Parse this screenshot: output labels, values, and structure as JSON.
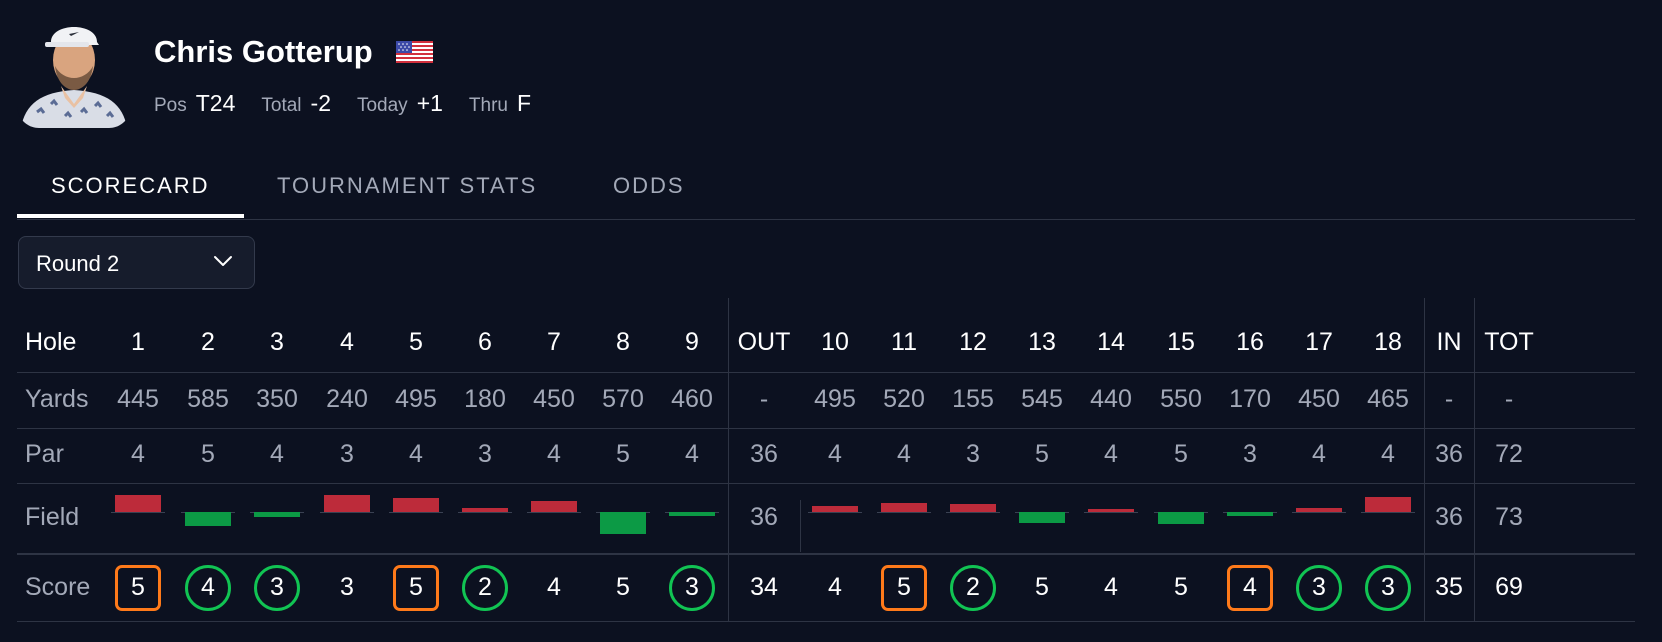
{
  "player": {
    "name": "Chris Gotterup",
    "flag_icon": "us-flag-icon",
    "stats": [
      {
        "label": "Pos",
        "value": "T24"
      },
      {
        "label": "Total",
        "value": "-2"
      },
      {
        "label": "Today",
        "value": "+1"
      },
      {
        "label": "Thru",
        "value": "F"
      }
    ]
  },
  "tabs": [
    {
      "label": "SCORECARD",
      "active": true
    },
    {
      "label": "TOURNAMENT STATS",
      "active": false
    },
    {
      "label": "ODDS",
      "active": false
    }
  ],
  "round_select": {
    "value": "Round 2",
    "icon": "chevron-down-icon"
  },
  "colors": {
    "background": "#0c1120",
    "field_over_par": "#bd2b3a",
    "field_under_par": "#0c9a45",
    "bogey_outline": "#ff7a1a",
    "birdie_outline": "#11c453"
  },
  "scorecard": {
    "row_labels": {
      "hole": "Hole",
      "yards": "Yards",
      "par": "Par",
      "field": "Field",
      "score": "Score"
    },
    "columns": [
      "1",
      "2",
      "3",
      "4",
      "5",
      "6",
      "7",
      "8",
      "9",
      "OUT",
      "10",
      "11",
      "12",
      "13",
      "14",
      "15",
      "16",
      "17",
      "18",
      "IN",
      "TOT"
    ],
    "yards": [
      "445",
      "585",
      "350",
      "240",
      "495",
      "180",
      "450",
      "570",
      "460",
      "-",
      "495",
      "520",
      "155",
      "545",
      "440",
      "550",
      "170",
      "450",
      "465",
      "-",
      "-"
    ],
    "par": [
      "4",
      "5",
      "4",
      "3",
      "4",
      "3",
      "4",
      "5",
      "4",
      "36",
      "4",
      "4",
      "3",
      "5",
      "4",
      "5",
      "3",
      "4",
      "4",
      "36",
      "72"
    ],
    "field_text": {
      "out": "36",
      "in": "36",
      "tot": "73"
    },
    "field_vs_par": [
      0.17,
      -0.14,
      -0.05,
      0.17,
      0.14,
      0.04,
      0.11,
      -0.22,
      -0.04,
      0.06,
      0.09,
      0.08,
      -0.11,
      0.03,
      -0.12,
      -0.04,
      0.04,
      0.15
    ],
    "score": [
      "5",
      "4",
      "3",
      "3",
      "5",
      "2",
      "4",
      "5",
      "3",
      "34",
      "4",
      "5",
      "2",
      "5",
      "4",
      "5",
      "4",
      "3",
      "3",
      "35",
      "69"
    ],
    "score_marks": [
      "bogey",
      "birdie",
      "birdie",
      "",
      "bogey",
      "birdie",
      "",
      "",
      "birdie",
      "",
      "",
      "bogey",
      "birdie",
      "",
      "",
      "",
      "bogey",
      "birdie",
      "birdie",
      "",
      ""
    ]
  }
}
